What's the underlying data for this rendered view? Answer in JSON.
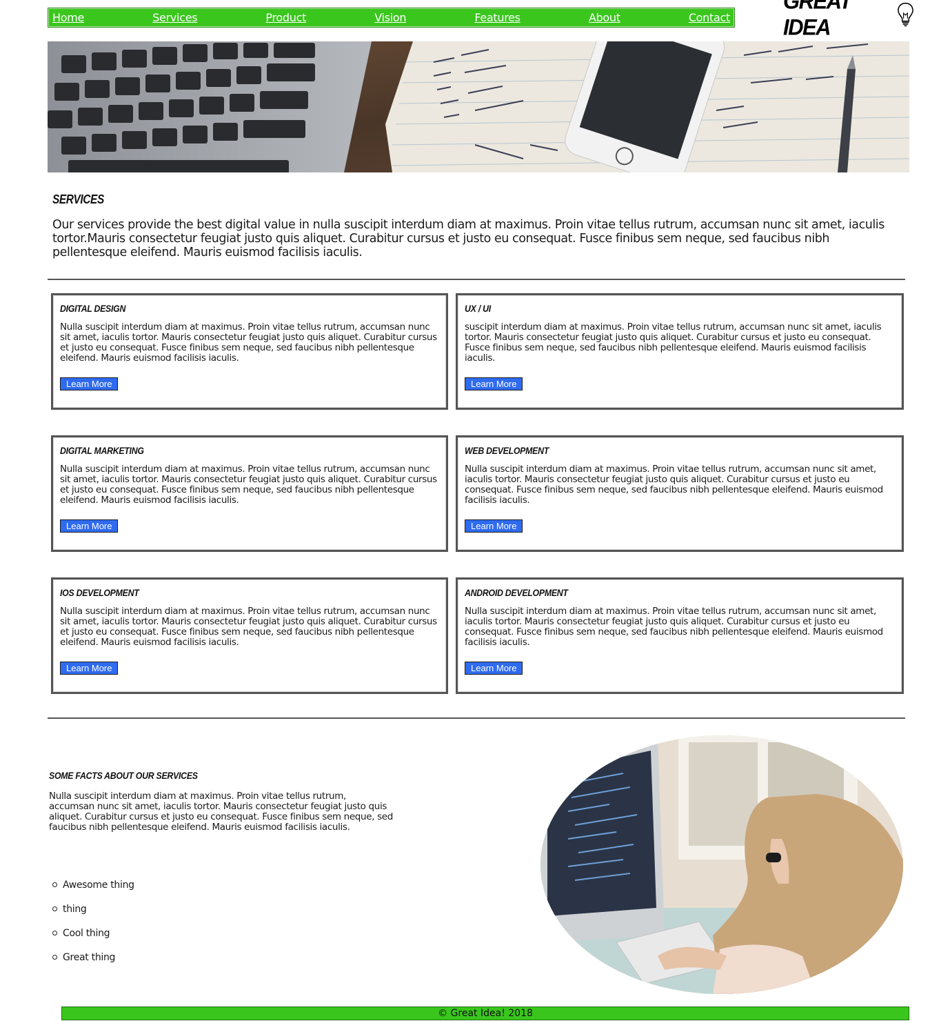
{
  "nav": {
    "items": [
      {
        "label": "Home"
      },
      {
        "label": "Services"
      },
      {
        "label": "Product"
      },
      {
        "label": "Vision"
      },
      {
        "label": "Features"
      },
      {
        "label": "About"
      },
      {
        "label": "Contact"
      }
    ],
    "color": "#3ac61d"
  },
  "logo": {
    "text": "GREAT IDEA",
    "icon": "lightbulb-icon"
  },
  "intro": {
    "title": "Services",
    "text": "Our services provide the best digital value in nulla suscipit interdum diam at maximus. Proin vitae tellus rutrum, accumsan nunc sit amet, iaculis tortor.Mauris consectetur feugiat justo quis aliquet. Curabitur cursus et justo eu consequat. Fusce finibus sem neque, sed faucibus nibh pellentesque eleifend. Mauris euismod facilisis iaculis."
  },
  "services": [
    {
      "title": "Digital Design",
      "text": "Nulla suscipit interdum diam at maximus. Proin vitae tellus rutrum, accumsan nunc sit amet, iaculis tortor. Mauris consectetur feugiat justo quis aliquet. Curabitur cursus et justo eu consequat. Fusce finibus sem neque, sed faucibus nibh pellentesque eleifend. Mauris euismod facilisis iaculis.",
      "button": "Learn More"
    },
    {
      "title": "UX / UI",
      "text": "suscipit interdum diam at maximus. Proin vitae tellus rutrum, accumsan nunc sit amet, iaculis tortor. Mauris consectetur feugiat justo quis aliquet. Curabitur cursus et justo eu consequat. Fusce finibus sem neque, sed faucibus nibh pellentesque eleifend. Mauris euismod facilisis iaculis.",
      "button": "Learn More"
    },
    {
      "title": "Digital Marketing",
      "text": "Nulla suscipit interdum diam at maximus. Proin vitae tellus rutrum, accumsan nunc sit amet, iaculis tortor. Mauris consectetur feugiat justo quis aliquet. Curabitur cursus et justo eu consequat. Fusce finibus sem neque, sed faucibus nibh pellentesque eleifend. Mauris euismod facilisis iaculis.",
      "button": "Learn More"
    },
    {
      "title": "Web Development",
      "text": "Nulla suscipit interdum diam at maximus. Proin vitae tellus rutrum, accumsan nunc sit amet, iaculis tortor. Mauris consectetur feugiat justo quis aliquet. Curabitur cursus et justo eu consequat. Fusce finibus sem neque, sed faucibus nibh pellentesque eleifend. Mauris euismod facilisis iaculis.",
      "button": "Learn More"
    },
    {
      "title": "iOS Development",
      "text": "Nulla suscipit interdum diam at maximus. Proin vitae tellus rutrum, accumsan nunc sit amet, iaculis tortor. Mauris consectetur feugiat justo quis aliquet. Curabitur cursus et justo eu consequat. Fusce finibus sem neque, sed faucibus nibh pellentesque eleifend. Mauris euismod facilisis iaculis.",
      "button": "Learn More"
    },
    {
      "title": "Android Development",
      "text": "Nulla suscipit interdum diam at maximus. Proin vitae tellus rutrum, accumsan nunc sit amet, iaculis tortor. Mauris consectetur feugiat justo quis aliquet. Curabitur cursus et justo eu consequat. Fusce finibus sem neque, sed faucibus nibh pellentesque eleifend. Mauris euismod facilisis iaculis.",
      "button": "Learn More"
    }
  ],
  "button_color": "#2f6bf0",
  "facts": {
    "title": "Some facts about our services",
    "text": "Nulla suscipit interdum diam at maximus. Proin vitae tellus rutrum, accumsan nunc sit amet, iaculis tortor. Mauris consectetur feugiat justo quis aliquet. Curabitur cursus et justo eu consequat. Fusce finibus sem neque, sed faucibus nibh pellentesque eleifend. Mauris euismod facilisis iaculis.",
    "items": [
      "Awesome thing",
      "thing",
      "Cool thing",
      "Great thing"
    ]
  },
  "footer": {
    "text": "© Great Idea! 2018"
  }
}
